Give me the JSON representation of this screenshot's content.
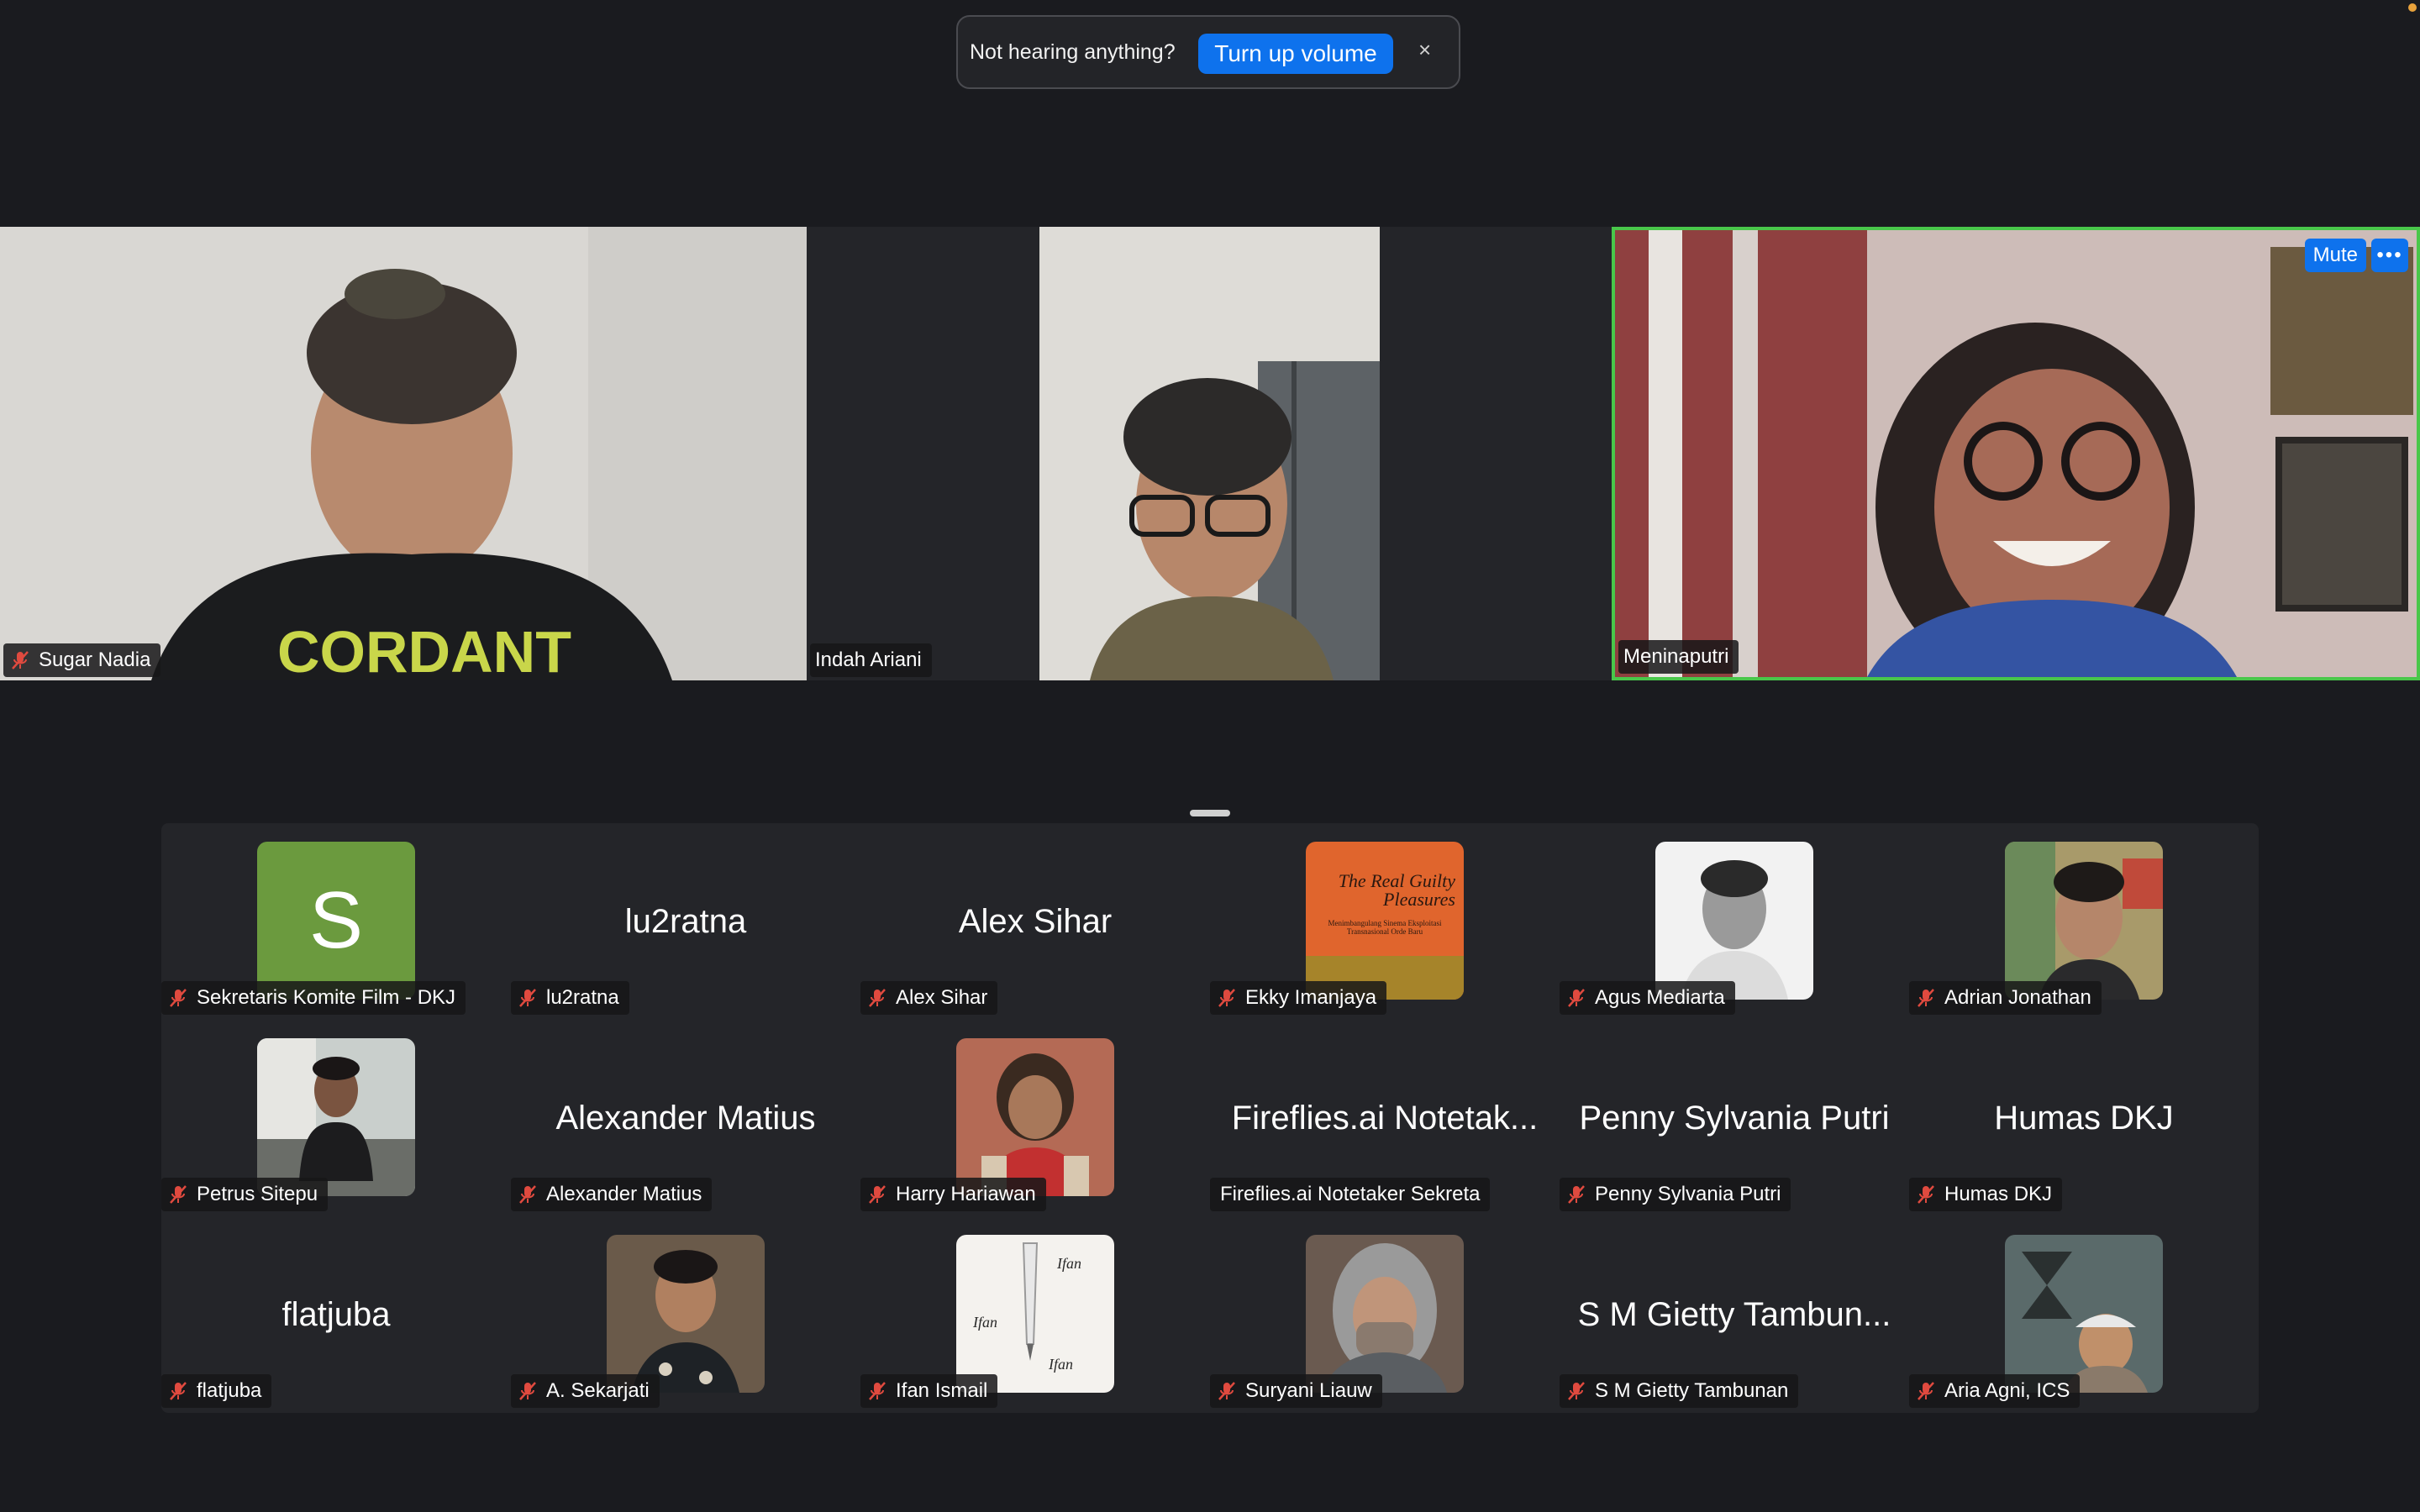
{
  "notification": {
    "text": "Not hearing anything?",
    "button": "Turn up volume",
    "close": "×"
  },
  "speakers": [
    {
      "name": "Sugar Nadia",
      "muted": true
    },
    {
      "name": "Indah Ariani",
      "muted": false
    },
    {
      "name": "Meninaputri",
      "muted": false,
      "active": true
    }
  ],
  "tile_controls": {
    "mute": "Mute",
    "more": "•••"
  },
  "gallery": [
    {
      "name": "Sekretaris Komite Film - DKJ",
      "muted": true,
      "initial": "S"
    },
    {
      "name": "lu2ratna",
      "muted": true,
      "display": "lu2ratna"
    },
    {
      "name": "Alex Sihar",
      "muted": true,
      "display": "Alex Sihar"
    },
    {
      "name": "Ekky Imanjaya",
      "muted": true,
      "book_title": "The Real Guilty Pleasures",
      "book_subtitle": "Menimbangulang Sinema Eksploitasi Transnasional Orde Baru"
    },
    {
      "name": "Agus Mediarta",
      "muted": true
    },
    {
      "name": "Adrian Jonathan",
      "muted": true
    },
    {
      "name": "Petrus Sitepu",
      "muted": true
    },
    {
      "name": "Alexander Matius",
      "muted": true,
      "display": "Alexander Matius"
    },
    {
      "name": "Harry Hariawan",
      "muted": true
    },
    {
      "name": "Fireflies.ai Notetaker Sekreta",
      "muted": false,
      "display": "Fireflies.ai Notetak..."
    },
    {
      "name": "Penny Sylvania Putri",
      "muted": true,
      "display": "Penny Sylvania Putri"
    },
    {
      "name": "Humas DKJ",
      "muted": true,
      "display": "Humas DKJ"
    },
    {
      "name": "flatjuba",
      "muted": true,
      "display": "flatjuba"
    },
    {
      "name": "A. Sekarjati",
      "muted": true
    },
    {
      "name": "Ifan Ismail",
      "muted": true
    },
    {
      "name": "Suryani Liauw",
      "muted": true
    },
    {
      "name": "S M Gietty Tambunan",
      "muted": true,
      "display": "S M Gietty Tambun..."
    },
    {
      "name": "Aria Agni, ICS",
      "muted": true
    }
  ],
  "colors": {
    "accent": "#0e72ed",
    "active_border": "#49c74a",
    "muted_icon": "#e04a3f",
    "initial_bg": "#6b9a3e"
  }
}
